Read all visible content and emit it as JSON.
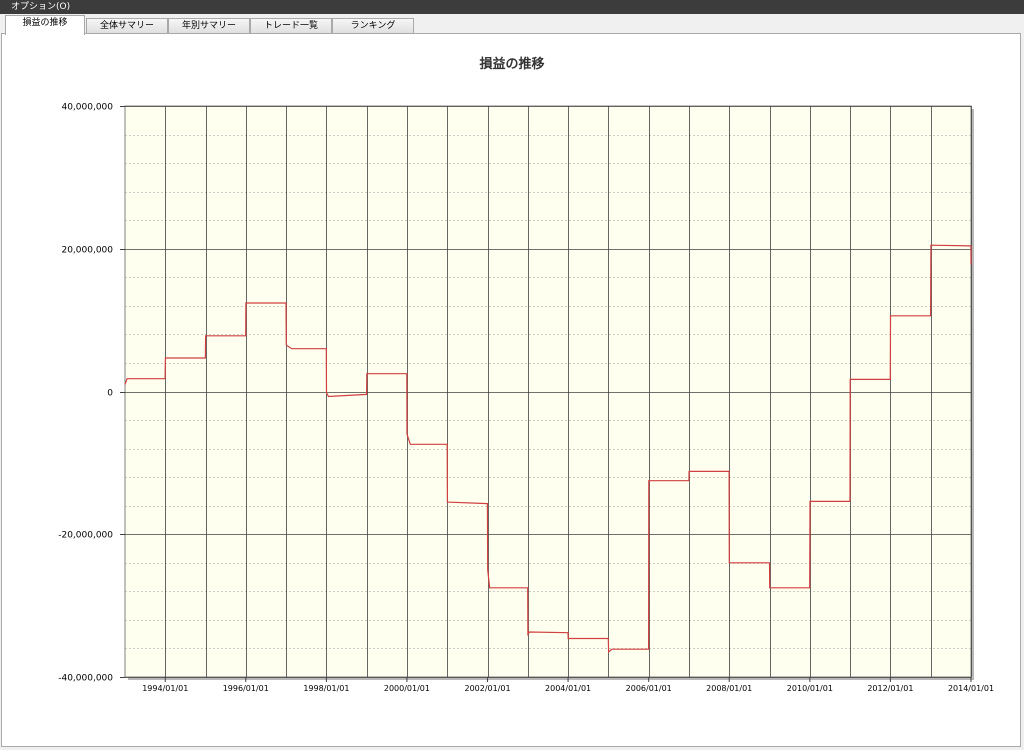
{
  "menu": {
    "options_label": "オプション(O)"
  },
  "tabs": [
    {
      "label": "損益の推移",
      "active": true
    },
    {
      "label": "全体サマリー",
      "active": false
    },
    {
      "label": "年別サマリー",
      "active": false
    },
    {
      "label": "トレード一覧",
      "active": false
    },
    {
      "label": "ランキング",
      "active": false
    }
  ],
  "colors": {
    "plot_background": "#fffff0",
    "series_line": "#d04040",
    "major_grid": "#404040",
    "minor_grid": "#999999"
  },
  "chart_data": {
    "type": "line",
    "title": "損益の推移",
    "xlabel": "",
    "ylabel": "",
    "x_type": "date",
    "xlim": [
      "1993-01-01",
      "2014-01-01"
    ],
    "ylim": [
      -40000000,
      40000000
    ],
    "y_ticks": [
      40000000,
      20000000,
      0,
      -20000000,
      -40000000
    ],
    "y_tick_labels": [
      "40,000,000",
      "20,000,000",
      "0",
      "-20,000,000",
      "-40,000,000"
    ],
    "x_tick_labels": [
      "1994/01/01",
      "1996/01/01",
      "1998/01/01",
      "2000/01/01",
      "2002/01/01",
      "2004/01/01",
      "2006/01/01",
      "2008/01/01",
      "2010/01/01",
      "2012/01/01",
      "2014/01/01"
    ],
    "grid": true,
    "legend": "none",
    "series": [
      {
        "x": [
          "1993-01-01",
          "1993-01-20",
          "1993-12-31",
          "1994-01-02",
          "1994-12-31",
          "1995-01-02",
          "1995-12-31",
          "1996-01-02",
          "1996-12-31",
          "1997-01-02",
          "1997-02-20",
          "1997-12-31",
          "1998-01-02",
          "1998-01-20",
          "1998-12-31",
          "1999-01-02",
          "1999-12-31",
          "2000-01-02",
          "2000-02-01",
          "2000-12-31",
          "2001-01-02",
          "2001-12-31",
          "2002-01-02",
          "2002-01-20",
          "2002-12-31",
          "2003-01-02",
          "2003-01-15",
          "2003-12-31",
          "2004-01-02",
          "2004-12-31",
          "2005-01-02",
          "2005-02-01",
          "2005-12-31",
          "2006-01-02",
          "2006-12-31",
          "2007-01-02",
          "2007-12-31",
          "2008-01-02",
          "2008-12-31",
          "2009-01-02",
          "2009-12-31",
          "2010-01-02",
          "2010-12-31",
          "2011-01-02",
          "2011-12-31",
          "2012-01-02",
          "2012-12-31",
          "2013-01-02",
          "2013-12-31",
          "2014-01-01"
        ],
        "y": [
          1000000,
          1800000,
          1800000,
          4700000,
          4700000,
          7800000,
          7800000,
          12400000,
          12400000,
          6500000,
          6000000,
          6000000,
          -200000,
          -700000,
          -400000,
          2500000,
          2500000,
          -6000000,
          -7400000,
          -7400000,
          -15500000,
          -15700000,
          -25000000,
          -27500000,
          -27500000,
          -34000000,
          -33700000,
          -33800000,
          -34600000,
          -34600000,
          -36500000,
          -36100000,
          -36100000,
          -12500000,
          -12500000,
          -11200000,
          -11200000,
          -24000000,
          -24000000,
          -27500000,
          -27500000,
          -15400000,
          -15400000,
          1700000,
          1700000,
          10600000,
          10600000,
          20500000,
          20400000,
          17800000
        ]
      }
    ]
  }
}
